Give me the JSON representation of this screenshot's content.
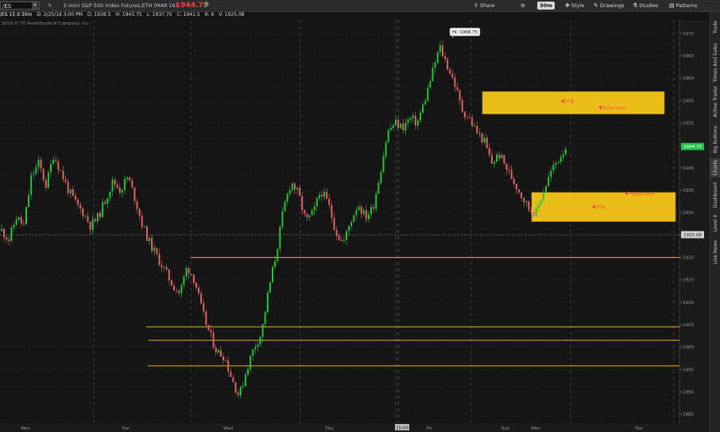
{
  "toolbar": {
    "symbol": "/ES",
    "description": "E-mini S&P 500 Index Futures,ETH (MAR 16)",
    "last_price": "1944.75",
    "share_label": "Share",
    "timeframe": "30m",
    "style_label": "Style",
    "drawings_label": "Drawings",
    "studies_label": "Studies",
    "patterns_label": "Patterns"
  },
  "info_bar": {
    "symbol_period": "/ES 15 d 30m",
    "date": "D: 2/25/16 3:00 PM",
    "open": "O: 1938.5",
    "high": "H: 1943.75",
    "low": "L: 1937.75",
    "close": "C: 1941.5",
    "range": "R: 6",
    "volume": "V: 1925.08"
  },
  "copyright": "2016 © TD Ameritrade IP Company, Inc.",
  "side_tabs": [
    "Trade",
    "Times And Sales",
    "Active Trader",
    "Big Buttons",
    "Charts",
    "Dashboard",
    "Level II",
    "Live News"
  ],
  "colors": {
    "up": "#27c63a",
    "down": "#e06565",
    "zone": "#ebbd1a",
    "hline": "#e0b422",
    "price_label": "#24c44a",
    "marker": "#ff3b3b"
  },
  "chart_data": {
    "type": "candlestick",
    "ylim": [
      1883,
      1973
    ],
    "y_ticks": [
      1970,
      1965,
      1960,
      1955,
      1950,
      1945,
      1940,
      1935,
      1930,
      1925,
      1920,
      1915,
      1910,
      1905,
      1900,
      1895,
      1890,
      1885
    ],
    "x_labels": [
      "Mon",
      "Tue",
      "Wed",
      "Thu",
      "15:00",
      "Fri",
      "Sun",
      "Mon",
      "Tue"
    ],
    "high_label": "Hi: 1968.75",
    "current_price": "1944.75",
    "reference_price": "1925.08",
    "horizontal_lines": [
      1920,
      1904.5,
      1901.5,
      1895.8
    ],
    "zones": [
      {
        "y_top": 1957,
        "y_bottom": 1952,
        "labels": [
          "FTR",
          "Entry here"
        ]
      },
      {
        "y_top": 1934.5,
        "y_bottom": 1928,
        "labels": [
          "Target here",
          "FTR"
        ]
      }
    ],
    "anchors": [
      1926,
      1924,
      1929,
      1927,
      1938,
      1941,
      1936,
      1943,
      1939,
      1935,
      1932,
      1930,
      1927,
      1929,
      1933,
      1937,
      1935,
      1938,
      1933,
      1927,
      1923,
      1920,
      1917,
      1914,
      1912,
      1918,
      1915,
      1908,
      1903,
      1899,
      1898,
      1893,
      1889,
      1895,
      1900,
      1903,
      1913,
      1921,
      1931,
      1937,
      1934,
      1928,
      1930,
      1935,
      1932,
      1926,
      1923,
      1928,
      1932,
      1929,
      1931,
      1939,
      1948,
      1950,
      1949,
      1951,
      1950,
      1955,
      1961,
      1967,
      1963,
      1959,
      1953,
      1951,
      1948,
      1946,
      1941,
      1943,
      1940,
      1937,
      1934,
      1931,
      1930,
      1935,
      1939,
      1942,
      1944.75
    ]
  }
}
